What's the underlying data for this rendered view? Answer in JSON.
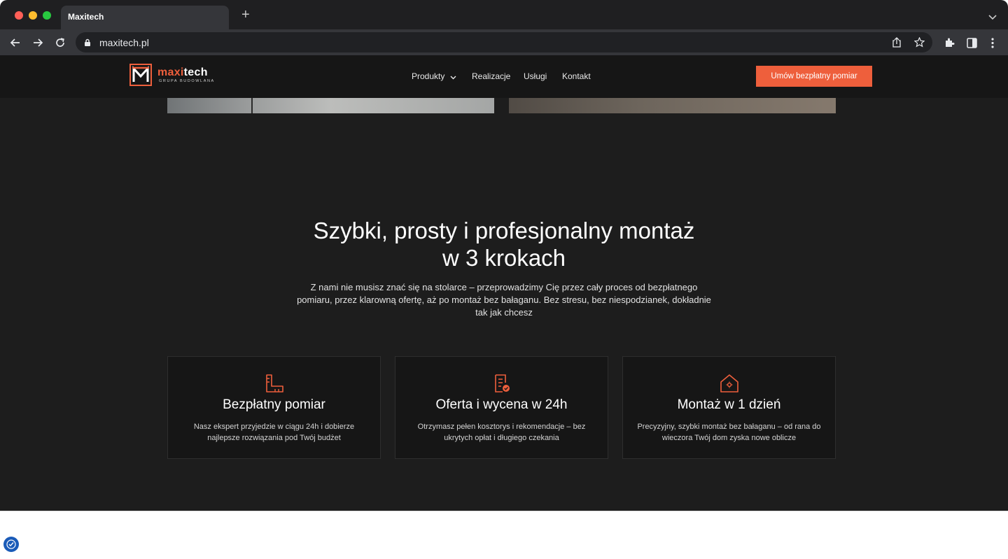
{
  "browser": {
    "tab_title": "Maxitech",
    "new_tab_label": "+",
    "url": "maxitech.pl"
  },
  "header": {
    "logo": {
      "word_a": "maxi",
      "word_b": "tech",
      "tagline": "GRUPA BUDOWLANA"
    },
    "nav": {
      "products": "Produkty",
      "realizations": "Realizacje",
      "services": "Usługi",
      "contact": "Kontakt"
    },
    "cta": "Umów bezpłatny pomiar"
  },
  "hero": {
    "headline_line1": "Szybki, prosty i profesjonalny montaż",
    "headline_line2": "w 3 krokach",
    "lead": "Z nami nie musisz znać się na stolarce – przeprowadzimy Cię przez cały proces od bezpłatnego pomiaru, przez klarowną ofertę, aż po montaż bez bałaganu. Bez stresu, bez niespodzianek, dokładnie tak jak chcesz"
  },
  "steps": [
    {
      "icon": "ruler-icon",
      "title": "Bezpłatny pomiar",
      "text": "Nasz ekspert przyjedzie w ciągu 24h i dobierze najlepsze rozwiązania pod Twój budżet"
    },
    {
      "icon": "document-check-icon",
      "title": "Oferta i wycena w 24h",
      "text": "Otrzymasz pełen kosztorys i rekomendacje – bez ukrytych opłat i długiego czekania"
    },
    {
      "icon": "house-gear-icon",
      "title": "Montaż w 1 dzień",
      "text": "Precyzyjny, szybki montaż bez bałaganu – od rana do wieczora Twój dom zyska nowe oblicze"
    }
  ],
  "colors": {
    "accent": "#ee5f3c",
    "page_bg": "#1d1d1d",
    "header_bg": "#161616"
  }
}
